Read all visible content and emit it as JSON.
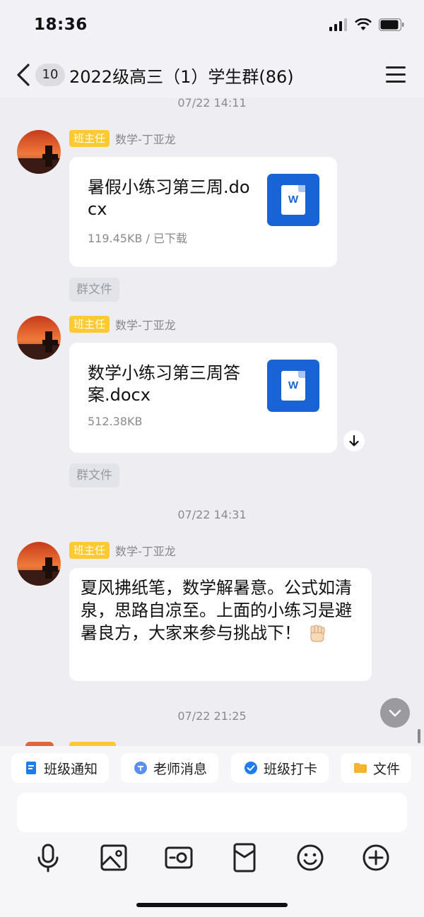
{
  "status": {
    "time": "18:36"
  },
  "header": {
    "unread": "10",
    "title": "2022级高三（1）学生群(86)"
  },
  "messages": [
    {
      "timestamp": "07/22 14:11",
      "role": "班主任",
      "sender": "数学-丁亚龙",
      "file_name": "暑假小练习第三周.docx",
      "file_meta": "119.45KB / 已下载",
      "file_icon": "W",
      "tag": "群文件"
    },
    {
      "role": "班主任",
      "sender": "数学-丁亚龙",
      "file_name": "数学小练习第三周答案.docx",
      "file_meta": "512.38KB",
      "file_icon": "W",
      "tag": "群文件"
    },
    {
      "timestamp": "07/22 14:31",
      "role": "班主任",
      "sender": "数学-丁亚龙",
      "text": "夏风拂纸笔，数学解暑意。公式如清泉，思路自凉至。上面的小练习是避暑良方，大家来参与挑战下！"
    },
    {
      "timestamp": "07/22 21:25"
    }
  ],
  "quick_actions": [
    {
      "label": "班级通知",
      "icon": "notice-icon",
      "color": "#1f7cf0"
    },
    {
      "label": "老师消息",
      "icon": "teacher-icon",
      "color": "#5c8ff0"
    },
    {
      "label": "班级打卡",
      "icon": "checkin-icon",
      "color": "#1f7cf0"
    },
    {
      "label": "文件",
      "icon": "folder-icon",
      "color": "#f5b42d"
    }
  ],
  "toolbar_icons": [
    "microphone-icon",
    "image-icon",
    "camera-icon",
    "red-packet-icon",
    "emoji-icon",
    "plus-icon"
  ],
  "colors": {
    "role_badge": "#ffc931",
    "word_blue": "#1864d6",
    "background": "#ededf2"
  }
}
